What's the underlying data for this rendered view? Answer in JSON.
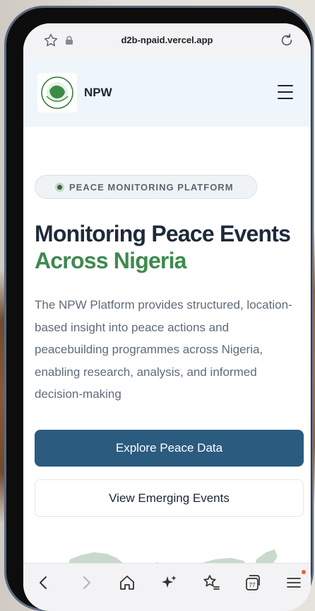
{
  "browser": {
    "url": "d2b-npaid.vercel.app",
    "tab_count": "77",
    "icons": [
      "star-icon",
      "lock-icon",
      "reload-icon",
      "back-icon",
      "forward-icon",
      "home-icon",
      "sparkle-icon",
      "bookmarks-icon",
      "tabs-icon",
      "menu-icon"
    ]
  },
  "header": {
    "brand": "NPW"
  },
  "hero": {
    "badge": "PEACE MONITORING PLATFORM",
    "headline_part1": "Monitoring Peace Events",
    "headline_accent": "Across Nigeria",
    "description": "The NPW Platform provides structured, location-based insight into peace actions and peacebuilding programmes across Nigeria, enabling research, analysis, and informed decision-making",
    "primary_button": "Explore Peace Data",
    "secondary_button": "View Emerging Events"
  },
  "colors": {
    "primary": "#2c5b80",
    "accent_green": "#3e8a4f",
    "heading": "#1e2a3a",
    "header_bg": "#eef6fb"
  }
}
